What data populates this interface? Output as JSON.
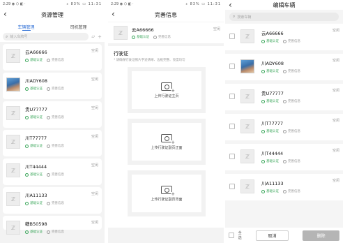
{
  "panel1": {
    "status_left": "2:29 ◉ ⬡ ◧ ·",
    "status_right": "⁎ 83% ▭ 11:31",
    "title": "资源管理",
    "tabs": [
      {
        "label": "车辆管理",
        "active": true
      },
      {
        "label": "司机管理",
        "active": false
      }
    ],
    "search_placeholder": "输入车牌号",
    "vehicles": [
      {
        "plate": "云A66666",
        "status": "空闲",
        "badge_ok": "基础认证",
        "badge_no": "完善信息",
        "photo": false
      },
      {
        "plate": "川ADY608",
        "status": "空闲",
        "badge_ok": "基础认证",
        "badge_no": "完善信息",
        "photo": true
      },
      {
        "plate": "贵U77777",
        "status": "空闲",
        "badge_ok": "基础认证",
        "badge_no": "完善信息",
        "photo": false
      },
      {
        "plate": "川T77777",
        "status": "空闲",
        "badge_ok": "基础认证",
        "badge_no": "完善信息",
        "photo": false
      },
      {
        "plate": "川T44444",
        "status": "空闲",
        "badge_ok": "基础认证",
        "badge_no": "完善信息",
        "photo": false
      },
      {
        "plate": "川A11133",
        "status": "空闲",
        "badge_ok": "基础认证",
        "badge_no": "完善信息",
        "photo": false
      },
      {
        "plate": "赣B50598",
        "status": "空闲",
        "badge_ok": "基础认证",
        "badge_no": "完善信息",
        "photo": false
      }
    ]
  },
  "panel2": {
    "status_left": "2:29 ◉ ⬡ ◧ ·",
    "status_right": "⁎ 83% ▭ 11:31",
    "title": "完善信息",
    "vehicle": {
      "plate": "云A66666",
      "status": "空闲",
      "badge_ok": "基础认证",
      "badge_no": "完善信息"
    },
    "section_title": "行驶证",
    "hint": "* 请确保行驶证照片字迹清晰、边框完整、亮度均匀",
    "uploads": [
      {
        "label": "上传行驶证主页"
      },
      {
        "label": "上传行驶证副页正面"
      },
      {
        "label": "上传行驶证副页背面"
      }
    ]
  },
  "panel3": {
    "title": "编辑车辆",
    "search_placeholder": "搜索车辆",
    "vehicles": [
      {
        "plate": "云A66666",
        "status": "空闲",
        "badge_ok": "基础认证",
        "badge_no": "完善信息",
        "photo": false
      },
      {
        "plate": "川ADY608",
        "status": "空闲",
        "badge_ok": "基础认证",
        "badge_no": "完善信息",
        "photo": true
      },
      {
        "plate": "贵U77777",
        "status": "空闲",
        "badge_ok": "基础认证",
        "badge_no": "完善信息",
        "photo": false
      },
      {
        "plate": "川T77777",
        "status": "空闲",
        "badge_ok": "基础认证",
        "badge_no": "完善信息",
        "photo": false
      },
      {
        "plate": "川T44444",
        "status": "空闲",
        "badge_ok": "基础认证",
        "badge_no": "完善信息",
        "photo": false
      },
      {
        "plate": "川A11133",
        "status": "空闲",
        "badge_ok": "基础认证",
        "badge_no": "完善信息",
        "photo": false
      }
    ],
    "select_all": "全选",
    "cancel": "取消",
    "delete": "删除"
  },
  "colors": {
    "accent": "#2e6fd6",
    "verified": "#3aa65a",
    "muted": "#999999"
  }
}
